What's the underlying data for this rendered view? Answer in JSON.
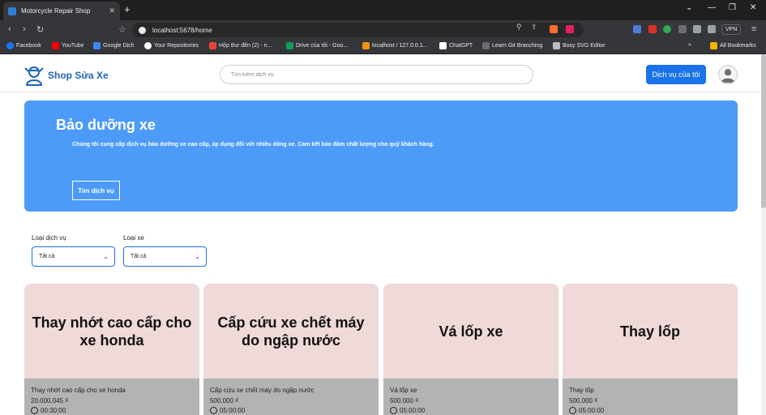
{
  "browser": {
    "tab_title": "Motorcycle Repair Shop",
    "url": "localhost:5678/home",
    "vpn_label": "VPN",
    "bookmarks": [
      "Facebook",
      "YouTube",
      "Google Dịch",
      "Your Repositories",
      "Hộp thư đến (2) - n...",
      "Drive của tôi - Goo...",
      "localhost / 127.0.0.1...",
      "ChatGPT",
      "Learn Git Branching",
      "Boxy SVG Editor"
    ],
    "all_bookmarks": "All Bookmarks"
  },
  "header": {
    "brand": "Shop Sửa Xe",
    "search_placeholder": "Tìm kiếm dịch vụ",
    "my_services": "Dịch vụ của tôi"
  },
  "hero": {
    "title": "Bảo dưỡng xe",
    "description": "Chúng tôi cung cấp dịch vụ bảo dưỡng xe cao cấp, áp dụng đối với nhiều dòng xe. Cam kết bảo đảm chất lượng cho quý khách hàng.",
    "button": "Tìm dịch vụ"
  },
  "filters": {
    "service_type_label": "Loại dịch vụ",
    "service_type_value": "Tất cả",
    "vehicle_type_label": "Loại xe",
    "vehicle_type_value": "Tất cả"
  },
  "services": [
    {
      "image_title": "Thay nhớt cao cấp cho xe honda",
      "name": "Thay nhớt cao cấp cho xe honda",
      "price": "20.000.045 ₫",
      "time": "00:30:00"
    },
    {
      "image_title": "Cấp cứu xe chết máy do ngập nước",
      "name": "Cấp cứu xe chết máy do ngập nước",
      "price": "500.000 ₫",
      "time": "05:00:00"
    },
    {
      "image_title": "Vá lốp xe",
      "name": "Vá lốp xe",
      "price": "500.000 ₫",
      "time": "05:00:00"
    },
    {
      "image_title": "Thay lốp",
      "name": "Thay lốp",
      "price": "500.000 ₫",
      "time": "05:00:00"
    }
  ]
}
